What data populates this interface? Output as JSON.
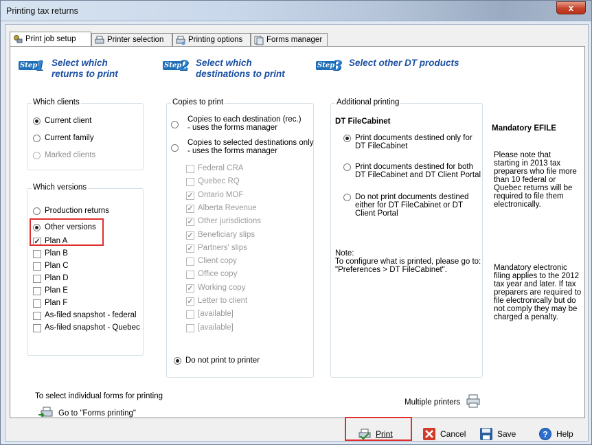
{
  "window": {
    "title": "Printing tax returns",
    "close_label": "x"
  },
  "tabs": [
    {
      "label": "Print job setup",
      "icon": "gear-printer-icon"
    },
    {
      "label": "Printer selection",
      "icon": "printer-icon"
    },
    {
      "label": "Printing options",
      "icon": "printer-options-icon"
    },
    {
      "label": "Forms manager",
      "icon": "forms-icon"
    }
  ],
  "steps": [
    {
      "badge": "Step",
      "num": "1",
      "text": "Select which returns to print"
    },
    {
      "badge": "Step",
      "num": "2",
      "text": "Select which destinations to print"
    },
    {
      "badge": "Step",
      "num": "3",
      "text": "Select other DT products"
    }
  ],
  "which_clients": {
    "title": "Which clients",
    "options": [
      "Current client",
      "Current family",
      "Marked clients"
    ],
    "selected": "Current client"
  },
  "which_versions": {
    "title": "Which versions",
    "production": "Production returns",
    "other": "Other versions",
    "selected": "Other versions",
    "plans": [
      {
        "label": "Plan A",
        "checked": true
      },
      {
        "label": "Plan B",
        "checked": false
      },
      {
        "label": "Plan C",
        "checked": false
      },
      {
        "label": "Plan D",
        "checked": false
      },
      {
        "label": "Plan E",
        "checked": false
      },
      {
        "label": "Plan F",
        "checked": false
      },
      {
        "label": "As-filed snapshot - federal",
        "checked": false
      },
      {
        "label": "As-filed snapshot - Quebec",
        "checked": false
      }
    ]
  },
  "copies": {
    "title": "Copies to print",
    "opt1_line1": "Copies to each destination (rec.)",
    "opt1_line2": "- uses the forms manager",
    "opt2_line1": "Copies to selected destinations only",
    "opt2_line2": "- uses the forms manager",
    "destinations": [
      {
        "label": "Federal CRA",
        "checked": false
      },
      {
        "label": "Quebec RQ",
        "checked": false
      },
      {
        "label": "Ontario MOF",
        "checked": true
      },
      {
        "label": "Alberta Revenue",
        "checked": true
      },
      {
        "label": "Other jurisdictions",
        "checked": true
      },
      {
        "label": "Beneficiary slips",
        "checked": true
      },
      {
        "label": "Partners' slips",
        "checked": true
      },
      {
        "label": "Client copy",
        "checked": false
      },
      {
        "label": "Office copy",
        "checked": false
      },
      {
        "label": "Working copy",
        "checked": true
      },
      {
        "label": "Letter to client",
        "checked": true
      },
      {
        "label": "[available]",
        "checked": false
      },
      {
        "label": "[available]",
        "checked": false
      }
    ],
    "no_print": "Do not print to printer",
    "selected": "Do not print to printer"
  },
  "additional": {
    "title": "Additional printing",
    "heading": "DT FileCabinet",
    "opt1_line1": "Print documents destined only for",
    "opt1_line2": "DT FileCabinet",
    "opt2_line1": "Print documents destined for both",
    "opt2_line2": "DT FileCabinet and DT Client Portal",
    "opt3_line1": "Do not print documents destined",
    "opt3_line2": "either for DT FileCabinet or DT",
    "opt3_line3": "Client Portal",
    "selected": "opt1",
    "note_label": "Note:",
    "note_line1": "To configure what is printed, please go to:",
    "note_line2": "\"Preferences > DT FileCabinet\"."
  },
  "efile": {
    "title": "Mandatory EFILE",
    "para1": [
      "Please note that",
      "starting in 2013 tax",
      "preparers who file more",
      "than 10 federal or",
      "Quebec returns will be",
      "required to file them",
      "electronically."
    ],
    "para2": [
      "Mandatory electronic",
      "filing applies to the 2012",
      "tax year and later. If tax",
      "preparers are required to",
      "file electronically but do",
      "not comply they may be",
      "charged a penalty."
    ]
  },
  "bottom": {
    "select_forms": "To select individual forms for printing",
    "goto_forms": "Go to \"Forms printing\"",
    "multiple_printers": "Multiple printers"
  },
  "buttons": {
    "print": "Print",
    "cancel": "Cancel",
    "save": "Save",
    "help": "Help"
  },
  "colors": {
    "step_text": "#1b4fa1",
    "highlight": "#e02d2d",
    "title_close": "#c7432b"
  }
}
